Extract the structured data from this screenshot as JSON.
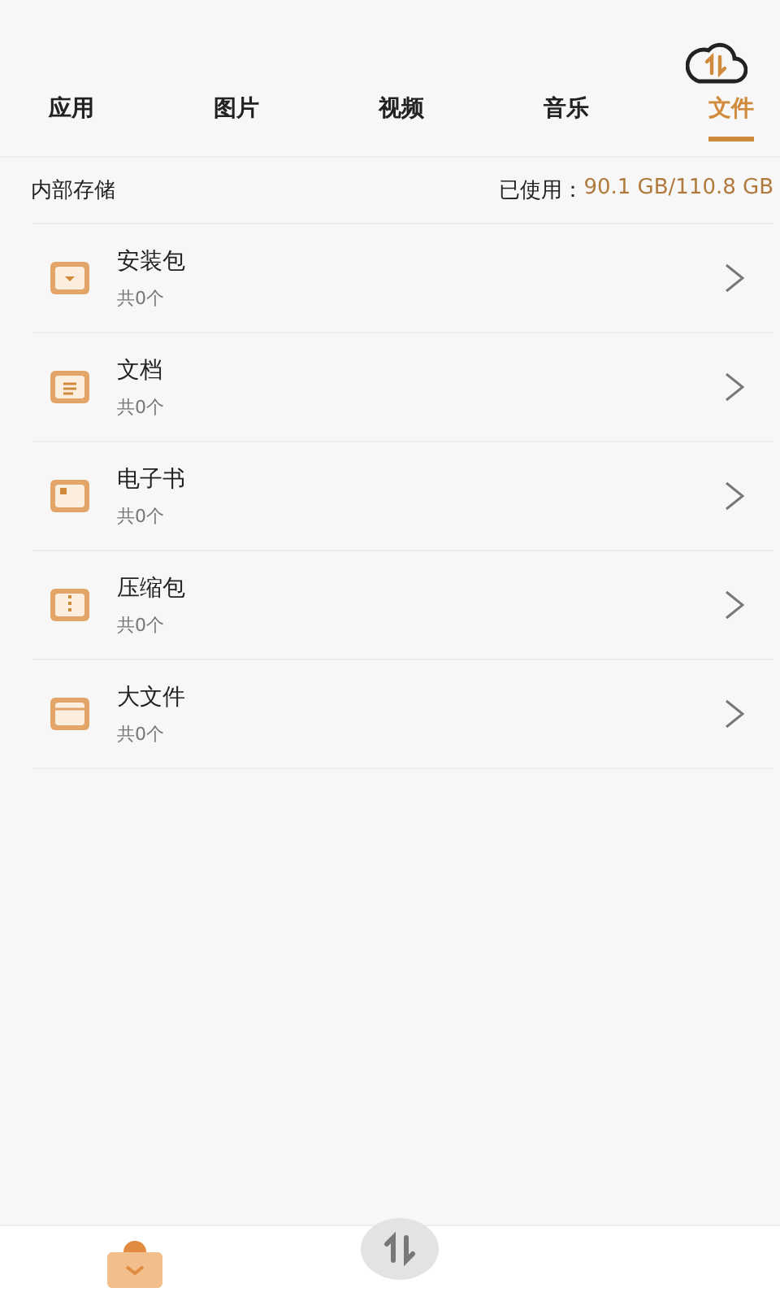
{
  "tabs": [
    {
      "label": "应用",
      "selected": false
    },
    {
      "label": "图片",
      "selected": false
    },
    {
      "label": "视频",
      "selected": false
    },
    {
      "label": "音乐",
      "selected": false
    },
    {
      "label": "文件",
      "selected": true
    }
  ],
  "storage": {
    "label": "内部存储",
    "used_label": "已使用：",
    "used_value": "90.1 GB/110.8 GB"
  },
  "categories": [
    {
      "kind": "package",
      "name": "安装包",
      "count": "共0个"
    },
    {
      "kind": "document",
      "name": "文档",
      "count": "共0个"
    },
    {
      "kind": "ebook",
      "name": "电子书",
      "count": "共0个"
    },
    {
      "kind": "archive",
      "name": "压缩包",
      "count": "共0个"
    },
    {
      "kind": "folder",
      "name": "大文件",
      "count": "共0个"
    }
  ]
}
